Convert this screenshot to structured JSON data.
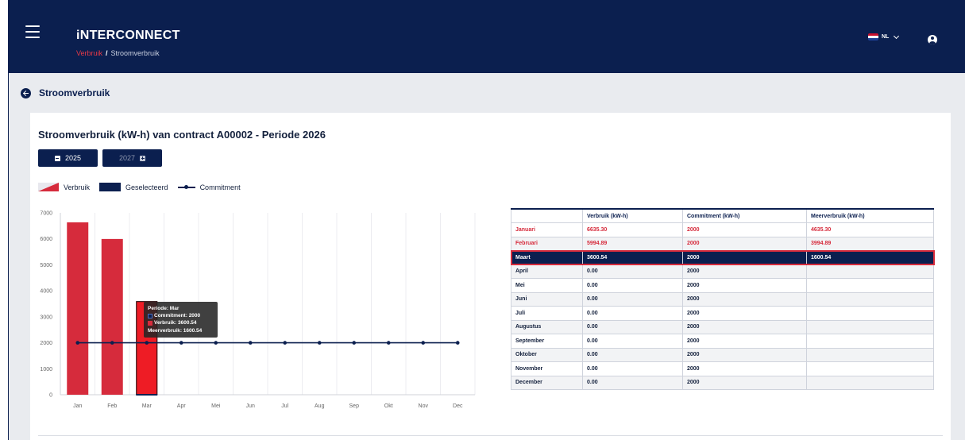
{
  "header": {
    "app_title": "iNTERCONNECT",
    "breadcrumb": [
      {
        "label": "Verbruik",
        "is_link": true
      },
      {
        "label": "Stroomverbruik",
        "is_link": false
      }
    ],
    "breadcrumb_separator": "/",
    "language": "NL",
    "icons": [
      "menu-icon",
      "flag-nl-icon",
      "chevron-down-icon",
      "user-icon"
    ]
  },
  "page": {
    "title": "Stroomverbruik",
    "back_icon": "arrow-left-circle-icon"
  },
  "card": {
    "title": "Stroomverbruik (kW-h) van contract A00002 - Periode 2026",
    "prev_year_label": "2025",
    "next_year_label": "2027",
    "legend": {
      "verbruik": "Verbruik",
      "geselecteerd": "Geselecteerd",
      "commitment": "Commitment"
    }
  },
  "colors": {
    "navy": "#0b1f4f",
    "red": "#d62b3c",
    "selected_bar": "#ee1c25"
  },
  "chart_data": {
    "type": "bar",
    "categories": [
      "Jan",
      "Feb",
      "Mar",
      "Apr",
      "Mei",
      "Jun",
      "Jul",
      "Aug",
      "Sep",
      "Okt",
      "Nov",
      "Dec"
    ],
    "series": [
      {
        "name": "Verbruik",
        "type": "bar",
        "values": [
          6635.3,
          5994.89,
          3600.54,
          0,
          0,
          0,
          0,
          0,
          0,
          0,
          0,
          0
        ]
      },
      {
        "name": "Commitment",
        "type": "line",
        "values": [
          2000,
          2000,
          2000,
          2000,
          2000,
          2000,
          2000,
          2000,
          2000,
          2000,
          2000,
          2000
        ]
      }
    ],
    "selected_index": 2,
    "ylim": [
      0,
      7000
    ],
    "yticks": [
      0,
      1000,
      2000,
      3000,
      4000,
      5000,
      6000,
      7000
    ],
    "grid": "vertical",
    "tooltip": {
      "periode": "Periode: Mar",
      "commitment": "Commitment: 2000",
      "verbruik": "Verbruik: 3600.54",
      "meerverbruik": "Meerverbruik: 1600.54"
    }
  },
  "table": {
    "headers": [
      "",
      "Verbruik (kW-h)",
      "Commitment (kW-h)",
      "Meerverbruik (kW-h)"
    ],
    "rows": [
      {
        "month": "Januari",
        "verbruik": "6635.30",
        "commitment": "2000",
        "meer": "4635.30",
        "status": "over"
      },
      {
        "month": "Februari",
        "verbruik": "5994.89",
        "commitment": "2000",
        "meer": "3994.89",
        "status": "over"
      },
      {
        "month": "Maart",
        "verbruik": "3600.54",
        "commitment": "2000",
        "meer": "1600.54",
        "status": "selected"
      },
      {
        "month": "April",
        "verbruik": "0.00",
        "commitment": "2000",
        "meer": "",
        "status": "normal"
      },
      {
        "month": "Mei",
        "verbruik": "0.00",
        "commitment": "2000",
        "meer": "",
        "status": "normal"
      },
      {
        "month": "Juni",
        "verbruik": "0.00",
        "commitment": "2000",
        "meer": "",
        "status": "normal"
      },
      {
        "month": "Juli",
        "verbruik": "0.00",
        "commitment": "2000",
        "meer": "",
        "status": "normal"
      },
      {
        "month": "Augustus",
        "verbruik": "0.00",
        "commitment": "2000",
        "meer": "",
        "status": "normal"
      },
      {
        "month": "September",
        "verbruik": "0.00",
        "commitment": "2000",
        "meer": "",
        "status": "normal"
      },
      {
        "month": "Oktober",
        "verbruik": "0.00",
        "commitment": "2000",
        "meer": "",
        "status": "normal"
      },
      {
        "month": "November",
        "verbruik": "0.00",
        "commitment": "2000",
        "meer": "",
        "status": "normal"
      },
      {
        "month": "December",
        "verbruik": "0.00",
        "commitment": "2000",
        "meer": "",
        "status": "normal"
      }
    ]
  }
}
